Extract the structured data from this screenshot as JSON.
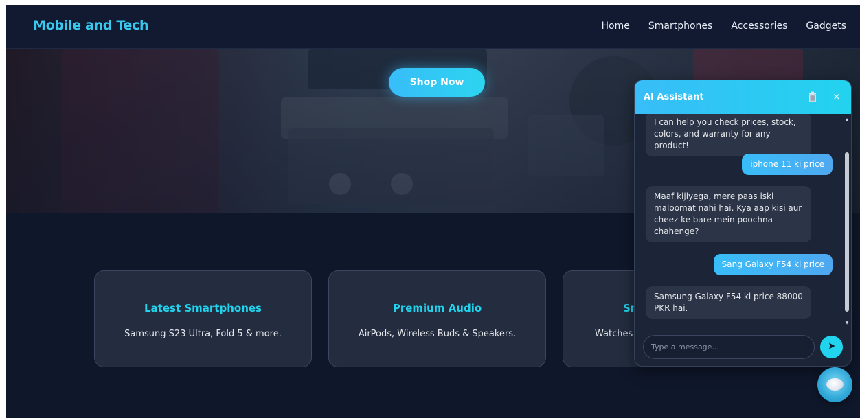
{
  "brand": "Mobile and Tech",
  "nav": {
    "items": [
      {
        "label": "Home"
      },
      {
        "label": "Smartphones"
      },
      {
        "label": "Accessories"
      },
      {
        "label": "Gadgets"
      }
    ]
  },
  "hero": {
    "cta_label": "Shop Now"
  },
  "cards": [
    {
      "title": "Latest Smartphones",
      "desc": "Samsung S23 Ultra, Fold 5 & more."
    },
    {
      "title": "Premium Audio",
      "desc": "AirPods, Wireless Buds & Speakers."
    },
    {
      "title": "Sm",
      "desc": "Watches"
    }
  ],
  "chat": {
    "title": "AI Assistant",
    "close_label": "×",
    "messages": [
      {
        "role": "bot",
        "text": "I can help you check prices, stock, colors, and warranty for any product!"
      },
      {
        "role": "user",
        "text": "iphone 11 ki price"
      },
      {
        "role": "bot",
        "text": "Maaf kijiyega, mere paas iski maloomat nahi hai. Kya aap kisi aur cheez ke bare mein poochna chahenge?"
      },
      {
        "role": "user",
        "text": "Sang Galaxy F54 ki price"
      },
      {
        "role": "bot",
        "text": "Samsung Galaxy F54 ki price 88000 PKR hai."
      }
    ],
    "input_placeholder": "Type a message...",
    "send_icon": "send-icon",
    "trash_icon": "trash-icon"
  },
  "colors": {
    "accent": "#22d3ee",
    "primary": "#38bdf8",
    "background": "#0f172a",
    "card": "#232d3f"
  }
}
